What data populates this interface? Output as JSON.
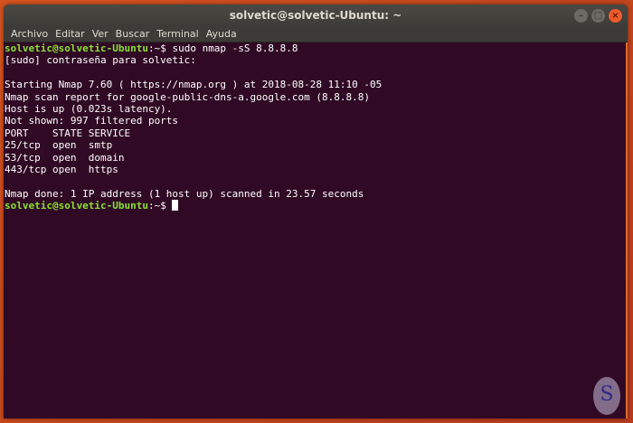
{
  "window": {
    "title": "solvetic@solvetic-Ubuntu: ~"
  },
  "menu": [
    "Archivo",
    "Editar",
    "Ver",
    "Buscar",
    "Terminal",
    "Ayuda"
  ],
  "terminal": {
    "prompt_user": "solvetic@solvetic-Ubuntu",
    "prompt_path": ":~$ ",
    "command": "sudo nmap -sS 8.8.8.8",
    "output": [
      "[sudo] contraseña para solvetic:",
      "",
      "Starting Nmap 7.60 ( https://nmap.org ) at 2018-08-28 11:10 -05",
      "Nmap scan report for google-public-dns-a.google.com (8.8.8.8)",
      "Host is up (0.023s latency).",
      "Not shown: 997 filtered ports",
      "PORT    STATE SERVICE",
      "25/tcp  open  smtp",
      "53/tcp  open  domain",
      "443/tcp open  https",
      "",
      "Nmap done: 1 IP address (1 host up) scanned in 23.57 seconds"
    ]
  },
  "watermark": {
    "text": "S"
  }
}
